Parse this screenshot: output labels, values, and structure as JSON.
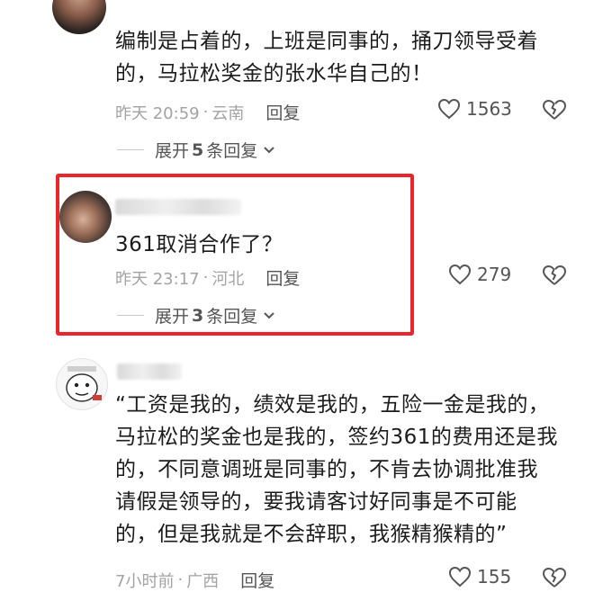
{
  "comments": [
    {
      "text_lines": [
        "编制是占着的，上班是同事的，捅刀领导受着",
        "的，马拉松奖金的张水华自己的！"
      ],
      "time": "昨天 20:59",
      "location": "云南",
      "reply_label": "回复",
      "likes": "1563",
      "expand_label": "展开",
      "expand_count": "5",
      "expand_suffix": "条回复"
    },
    {
      "text_lines": [
        "361取消合作了？"
      ],
      "time": "昨天 23:17",
      "location": "河北",
      "reply_label": "回复",
      "likes": "279",
      "expand_label": "展开",
      "expand_count": "3",
      "expand_suffix": "条回复",
      "highlighted": true
    },
    {
      "text_lines": [
        "“工资是我的，绩效是我的，五险一金是我的，",
        "马拉松的奖金也是我的，签约361的费用还是我",
        "的，不同意调班是同事的，不肯去协调批准我",
        "请假是领导的，要我请客讨好同事是不可能",
        "的，但是我就是不会辞职，我猴精猴精的”"
      ],
      "time": "7小时前",
      "location": "广西",
      "reply_label": "回复",
      "likes": "155"
    }
  ],
  "separator": "·",
  "colors": {
    "highlight_border": "#e8262c",
    "meta": "#a3a3a3",
    "text": "#1c1c1c"
  },
  "icons": [
    "heart-outline-icon",
    "broken-heart-icon",
    "chevron-down-icon"
  ]
}
